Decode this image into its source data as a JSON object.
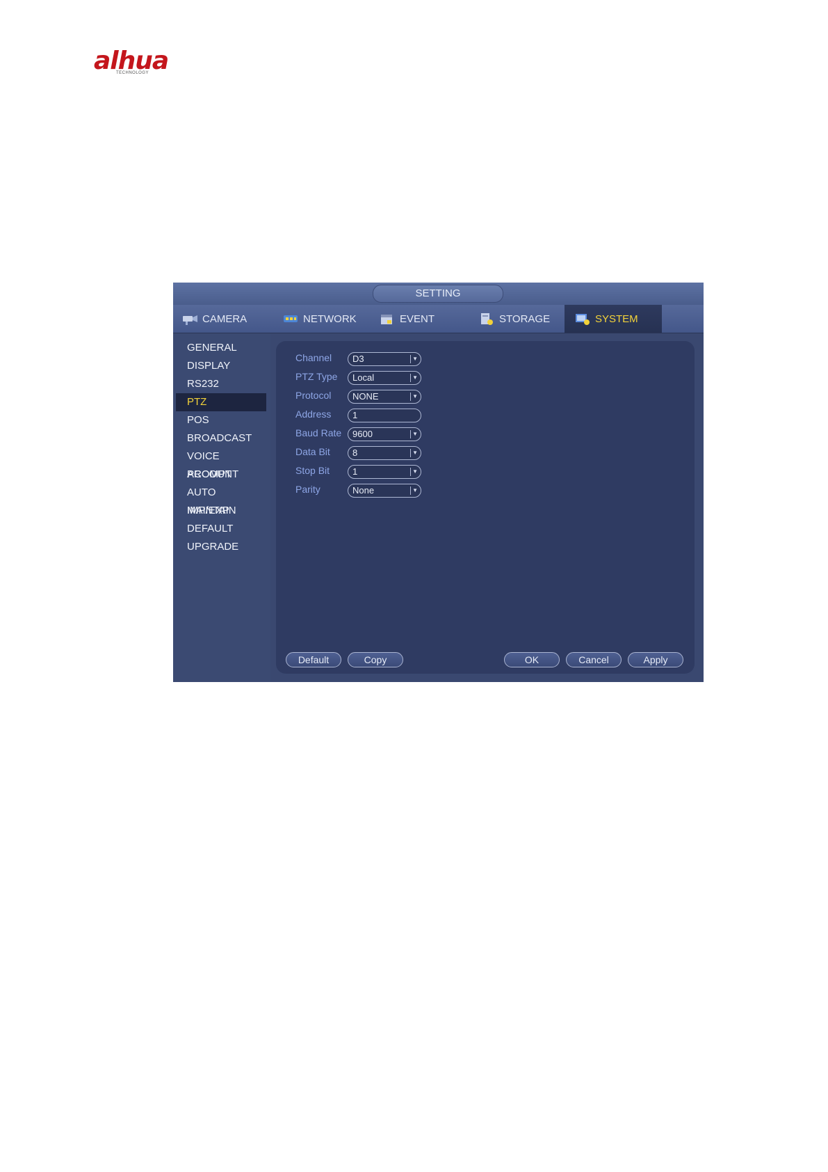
{
  "logo": {
    "brand": "alhua",
    "sub": "TECHNOLOGY"
  },
  "window": {
    "title": "SETTING"
  },
  "tabs": [
    {
      "label": "CAMERA",
      "icon": "camera-icon"
    },
    {
      "label": "NETWORK",
      "icon": "network-icon"
    },
    {
      "label": "EVENT",
      "icon": "event-icon"
    },
    {
      "label": "STORAGE",
      "icon": "storage-icon"
    },
    {
      "label": "SYSTEM",
      "icon": "system-icon",
      "active": true
    }
  ],
  "sidebar": {
    "items": [
      {
        "label": "GENERAL"
      },
      {
        "label": "DISPLAY"
      },
      {
        "label": "RS232"
      },
      {
        "label": "PTZ",
        "selected": true
      },
      {
        "label": "POS"
      },
      {
        "label": "BROADCAST"
      },
      {
        "label": "VOICE PROMPT"
      },
      {
        "label": "ACCOUNT"
      },
      {
        "label": "AUTO MAINTAIN"
      },
      {
        "label": "IMP/EXP"
      },
      {
        "label": "DEFAULT"
      },
      {
        "label": "UPGRADE"
      }
    ]
  },
  "form": {
    "fields": [
      {
        "label": "Channel",
        "value": "D3",
        "type": "select"
      },
      {
        "label": "PTZ Type",
        "value": "Local",
        "type": "select"
      },
      {
        "label": "Protocol",
        "value": "NONE",
        "type": "select"
      },
      {
        "label": "Address",
        "value": "1",
        "type": "input"
      },
      {
        "label": "Baud Rate",
        "value": "9600",
        "type": "select"
      },
      {
        "label": "Data Bit",
        "value": "8",
        "type": "select"
      },
      {
        "label": "Stop Bit",
        "value": "1",
        "type": "select"
      },
      {
        "label": "Parity",
        "value": "None",
        "type": "select"
      }
    ]
  },
  "buttons": {
    "default": "Default",
    "copy": "Copy",
    "ok": "OK",
    "cancel": "Cancel",
    "apply": "Apply"
  },
  "colors": {
    "accent_yellow": "#f2d23a",
    "label_blue": "#8ea6e6",
    "panel_bg": "#2f3b62",
    "logo_red": "#c4161c"
  }
}
